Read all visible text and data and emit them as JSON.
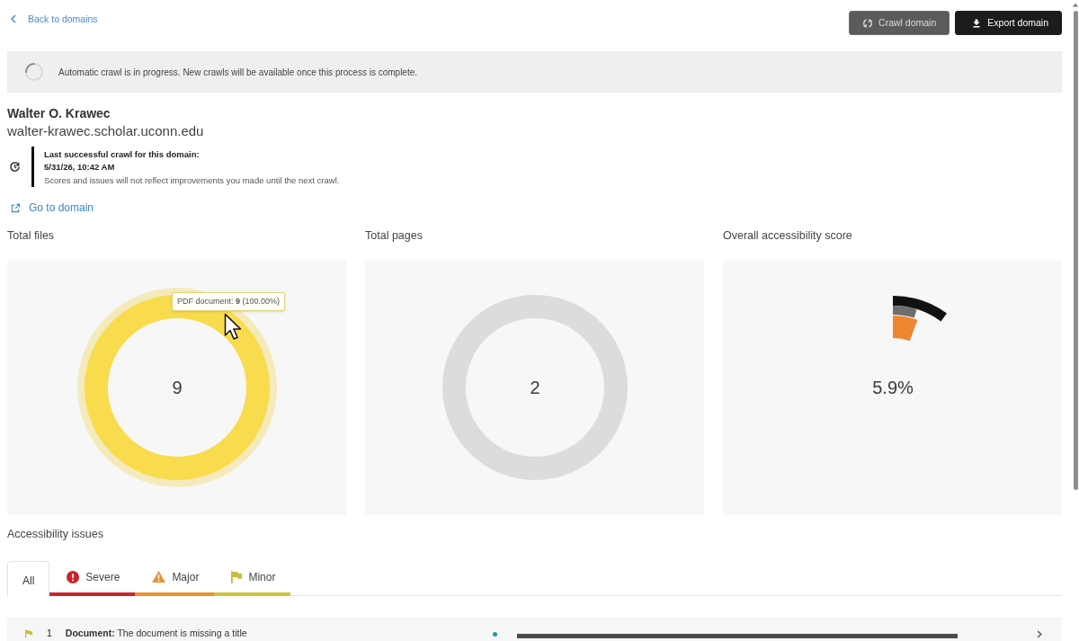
{
  "header": {
    "back_link": "Back to domains",
    "buttons": [
      {
        "kind": "crawl",
        "label": "Crawl domain",
        "disabled": true
      },
      {
        "kind": "export",
        "label": "Export domain",
        "disabled": false
      }
    ]
  },
  "banner": {
    "message": "Automatic crawl is in progress. New crawls will be available once this process is complete."
  },
  "domain": {
    "name": "Walter O. Krawec",
    "url": "walter-krawec.scholar.uconn.edu",
    "last_crawl": {
      "heading": "Last successful crawl for this domain:",
      "date": "5/31/26, 10:42 AM",
      "note": "Scores and issues will not reflect improvements you made until the next crawl."
    },
    "go_link": "Go to domain"
  },
  "stats": [
    {
      "kind": "donut",
      "title": "Total files",
      "center": "9",
      "color": "#f8dc4e",
      "tooltip": "PDF document: **9** (100.00%)"
    },
    {
      "kind": "donut",
      "title": "Total pages",
      "center": "2",
      "color": "#dcdcdc"
    },
    {
      "kind": "gauge",
      "title": "Overall accessibility score",
      "center": "5.9%"
    }
  ],
  "issues": {
    "title": "Accessibility issues",
    "tabs": [
      {
        "kind": "all",
        "label": "All",
        "selected": true
      },
      {
        "kind": "severe",
        "label": "Severe",
        "selected": false,
        "color": "#cc2229"
      },
      {
        "kind": "major",
        "label": "Major",
        "selected": false,
        "color": "#e8912f"
      },
      {
        "kind": "minor",
        "label": "Minor",
        "selected": false,
        "color": "#cdc43f"
      }
    ],
    "rows": [
      {
        "kind": "minor",
        "number": "1",
        "description": "**Document:** The document is missing a title"
      }
    ]
  }
}
